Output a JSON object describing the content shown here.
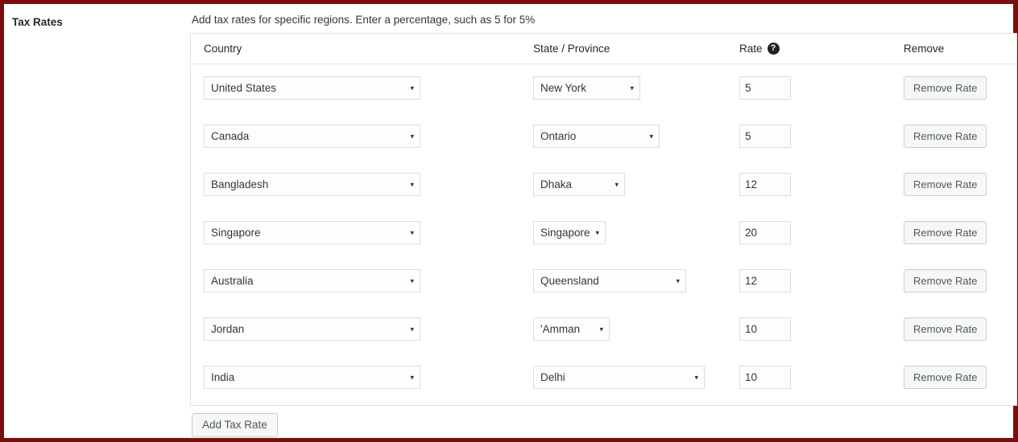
{
  "field": {
    "label": "Tax Rates",
    "description": "Add tax rates for specific regions. Enter a percentage, such as 5 for 5%"
  },
  "table": {
    "headers": {
      "country": "Country",
      "state": "State / Province",
      "rate": "Rate",
      "rate_help_icon": "help-icon",
      "rate_help_glyph": "?",
      "remove": "Remove"
    },
    "caret_glyph": "▾",
    "remove_label": "Remove Rate",
    "rows": [
      {
        "country": "United States",
        "state": "New York",
        "state_width": 133,
        "rate": "5",
        "remove": "Remove Rate"
      },
      {
        "country": "Canada",
        "state": "Ontario",
        "state_width": 157,
        "rate": "5",
        "remove": "Remove Rate"
      },
      {
        "country": "Bangladesh",
        "state": "Dhaka",
        "state_width": 114,
        "rate": "12",
        "remove": "Remove Rate"
      },
      {
        "country": "Singapore",
        "state": "Singapore",
        "state_width": 90,
        "rate": "20",
        "remove": "Remove Rate"
      },
      {
        "country": "Australia",
        "state": "Queensland",
        "state_width": 190,
        "rate": "12",
        "remove": "Remove Rate"
      },
      {
        "country": "Jordan",
        "state": "'Amman",
        "state_width": 95,
        "rate": "10",
        "remove": "Remove Rate"
      },
      {
        "country": "India",
        "state": "Delhi",
        "state_width": 213,
        "rate": "10",
        "remove": "Remove Rate"
      }
    ]
  },
  "actions": {
    "add_tax_rate": "Add Tax Rate"
  },
  "colors": {
    "frame_border": "#7d0d0d",
    "table_border": "#e1e1e1",
    "control_border": "#dddddd",
    "text": "#32373c",
    "label_text": "#23282d",
    "button_bg": "#f6f7f7",
    "help_icon_bg": "#1d2327"
  }
}
